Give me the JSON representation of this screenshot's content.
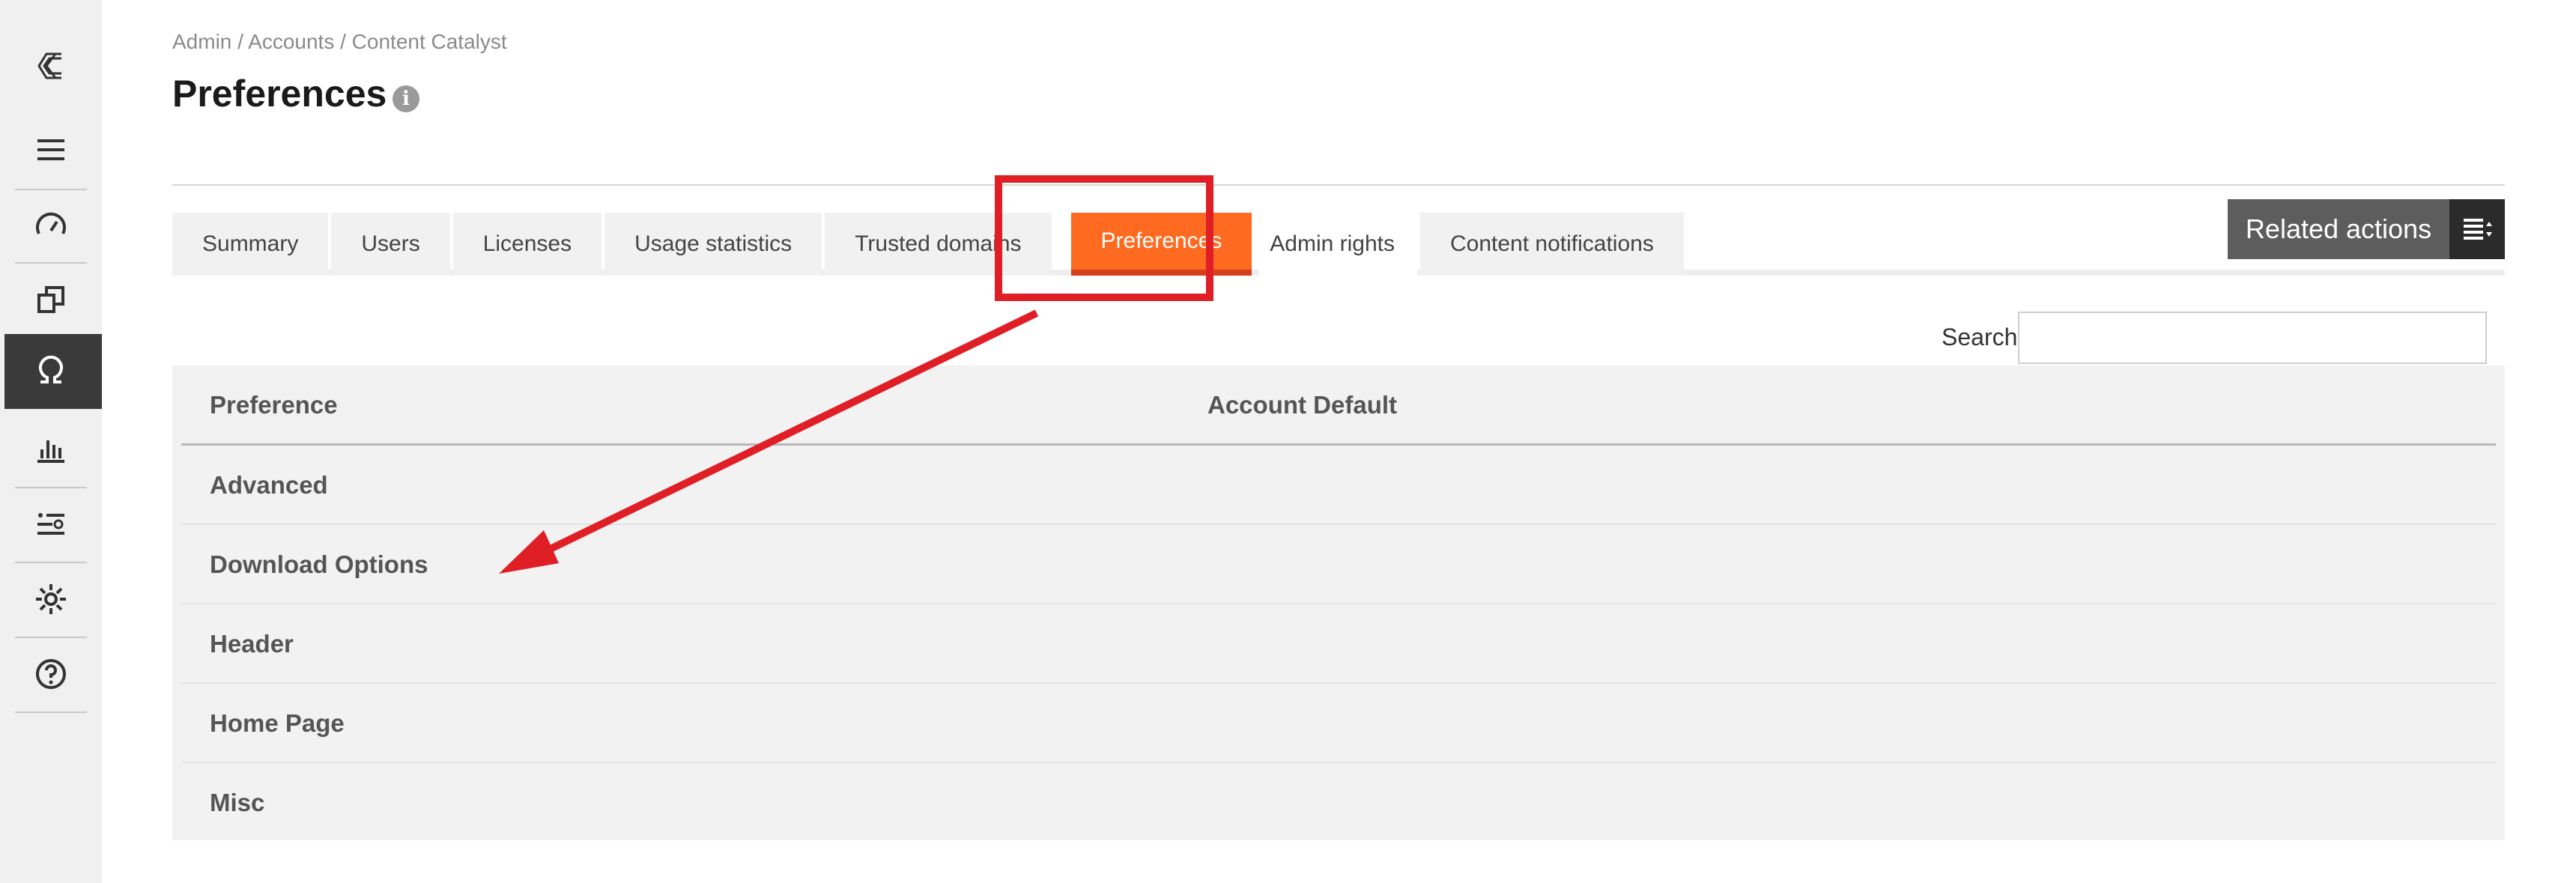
{
  "breadcrumb": "Admin / Accounts / Content Catalyst",
  "page_title": "Preferences",
  "info_icon_glyph": "i",
  "sidebar": {
    "items": [
      {
        "name": "logo-icon"
      },
      {
        "name": "menu-icon"
      },
      {
        "name": "dashboard-icon"
      },
      {
        "name": "copy-icon"
      },
      {
        "name": "omega-icon",
        "active": true
      },
      {
        "name": "bar-chart-icon"
      },
      {
        "name": "list-settings-icon"
      },
      {
        "name": "gear-icon"
      },
      {
        "name": "help-icon"
      }
    ]
  },
  "tabs": [
    {
      "label": "Summary"
    },
    {
      "label": "Users"
    },
    {
      "label": "Licenses"
    },
    {
      "label": "Usage statistics"
    },
    {
      "label": "Trusted domains"
    },
    {
      "label": "Preferences",
      "active": true
    },
    {
      "label": "Admin rights"
    },
    {
      "label": "Content notifications"
    }
  ],
  "related_actions": {
    "label": "Related actions",
    "icon": "list-menu-icon"
  },
  "search": {
    "label": "Search",
    "value": "",
    "placeholder": ""
  },
  "table": {
    "columns": [
      "Preference",
      "Account Default"
    ],
    "rows": [
      "Advanced",
      "Download Options",
      "Header",
      "Home Page",
      "Misc"
    ]
  },
  "annotation": {
    "color": "#e01e26",
    "target": "Preferences tab",
    "points_to": "Download Options"
  },
  "colors": {
    "accent": "#ff6a21",
    "sidebar_active": "#3a3a3a",
    "annotation": "#e01e26"
  }
}
